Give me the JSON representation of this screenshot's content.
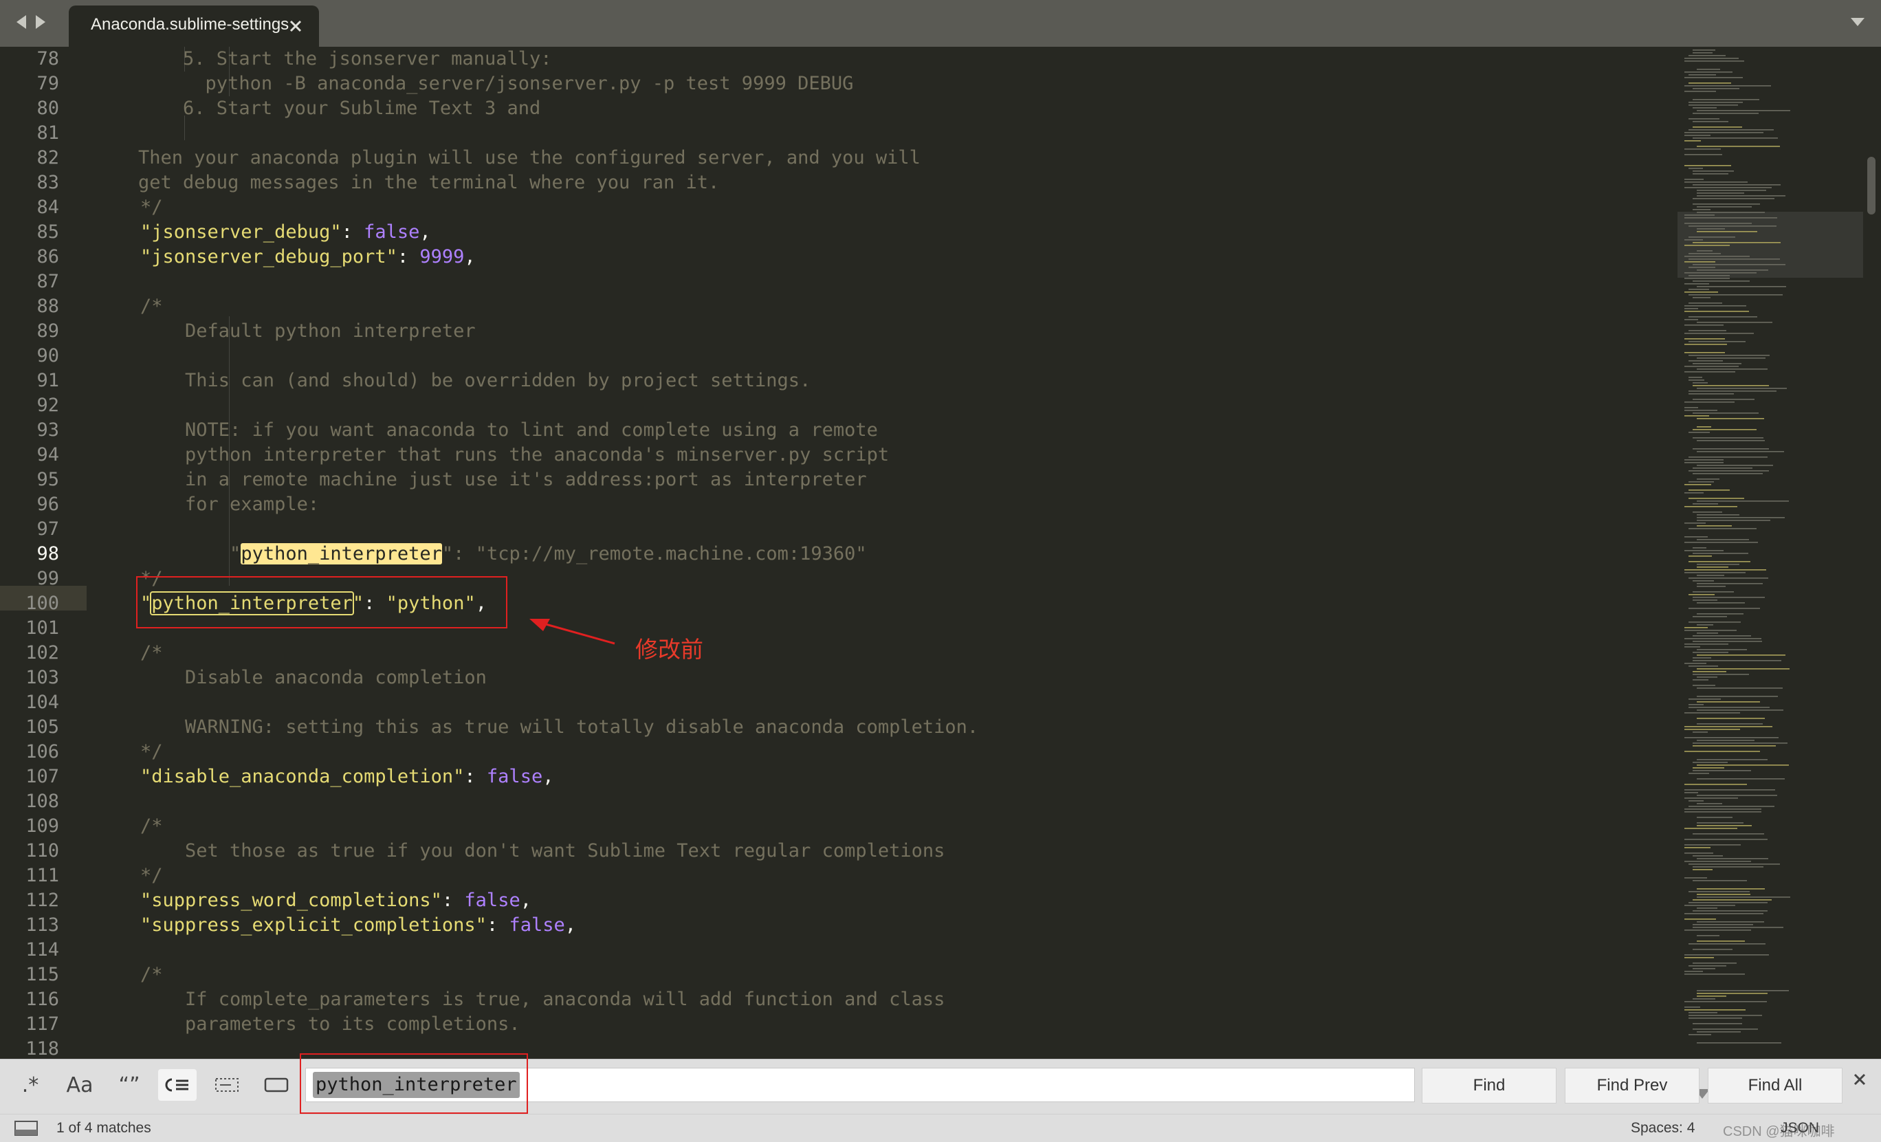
{
  "tab": {
    "title": "Anaconda.sublime-settings"
  },
  "icons": {
    "back": "left-arrow-icon",
    "forward": "right-arrow-icon",
    "tab_close": "close-icon",
    "tab_menu": "chevron-down-icon",
    "panel_toggle": "panel-icon",
    "find_close": "close-icon"
  },
  "colors": {
    "editor_bg": "#272822",
    "comment": "#75715e",
    "string": "#e6db74",
    "constant": "#ae81ff",
    "annotation_red": "#e02020"
  },
  "gutter": {
    "line_numbers": [
      "78",
      "79",
      "80",
      "81",
      "82",
      "83",
      "84",
      "85",
      "86",
      "87",
      "88",
      "89",
      "90",
      "91",
      "92",
      "93",
      "94",
      "95",
      "96",
      "97",
      "98",
      "99",
      "100",
      "101",
      "102",
      "103",
      "104",
      "105",
      "106",
      "107",
      "108",
      "109",
      "110",
      "111",
      "112",
      "113",
      "114",
      "115",
      "116",
      "117",
      "118"
    ],
    "active_line": "98"
  },
  "code": {
    "l78": "        5. Start the jsonserver manually:",
    "l79": "          python -B anaconda_server/jsonserver.py -p test 9999 DEBUG",
    "l80": "        6. Start your Sublime Text 3 and",
    "l82": "    Then your anaconda plugin will use the configured server, and you will",
    "l83": "    get debug messages in the terminal where you ran it.",
    "l84": "*/",
    "l85_key": "\"jsonserver_debug\"",
    "l85_val": "false",
    "l86_key": "\"jsonserver_debug_port\"",
    "l86_val": "9999",
    "l88": "/*",
    "l89": "    Default python interpreter",
    "l91": "    This can (and should) be overridden by project settings.",
    "l93": "    NOTE: if you want anaconda to lint and complete using a remote",
    "l94": "    python interpreter that runs the anaconda's minserver.py script",
    "l95": "    in a remote machine just use it's address:port as interpreter",
    "l96": "    for example:",
    "l98_pre": "        \"",
    "l98_match": "python_interpreter",
    "l98_post": "\": \"tcp://my_remote.machine.com:19360\"",
    "l99": "*/",
    "l100_q1": "\"",
    "l100_match": "python_interpreter",
    "l100_q2": "\"",
    "l100_colon": ": ",
    "l100_val": "\"python\"",
    "l100_comma": ",",
    "l102": "/*",
    "l103": "    Disable anaconda completion",
    "l105": "    WARNING: setting this as true will totally disable anaconda completion.",
    "l106": "*/",
    "l107_key": "\"disable_anaconda_completion\"",
    "l107_val": "false",
    "l109": "/*",
    "l110": "    Set those as true if you don't want Sublime Text regular completions",
    "l111": "*/",
    "l112_key": "\"suppress_word_completions\"",
    "l112_val": "false",
    "l113_key": "\"suppress_explicit_completions\"",
    "l113_val": "false",
    "l115": "/*",
    "l116": "    If complete_parameters is true, anaconda will add function and class",
    "l117": "    parameters to its completions."
  },
  "annotation": {
    "label": "修改前"
  },
  "find_panel": {
    "opt_regex": ".*",
    "opt_case": "Aa",
    "opt_word": "“”",
    "query": "python_interpreter",
    "find_label": "Find",
    "find_prev_label": "Find Prev",
    "find_all_label": "Find All"
  },
  "status": {
    "matches": "1 of 4 matches",
    "spaces": "Spaces: 4",
    "syntax": "JSON",
    "watermark": "CSDN @猫咪咖啡"
  }
}
